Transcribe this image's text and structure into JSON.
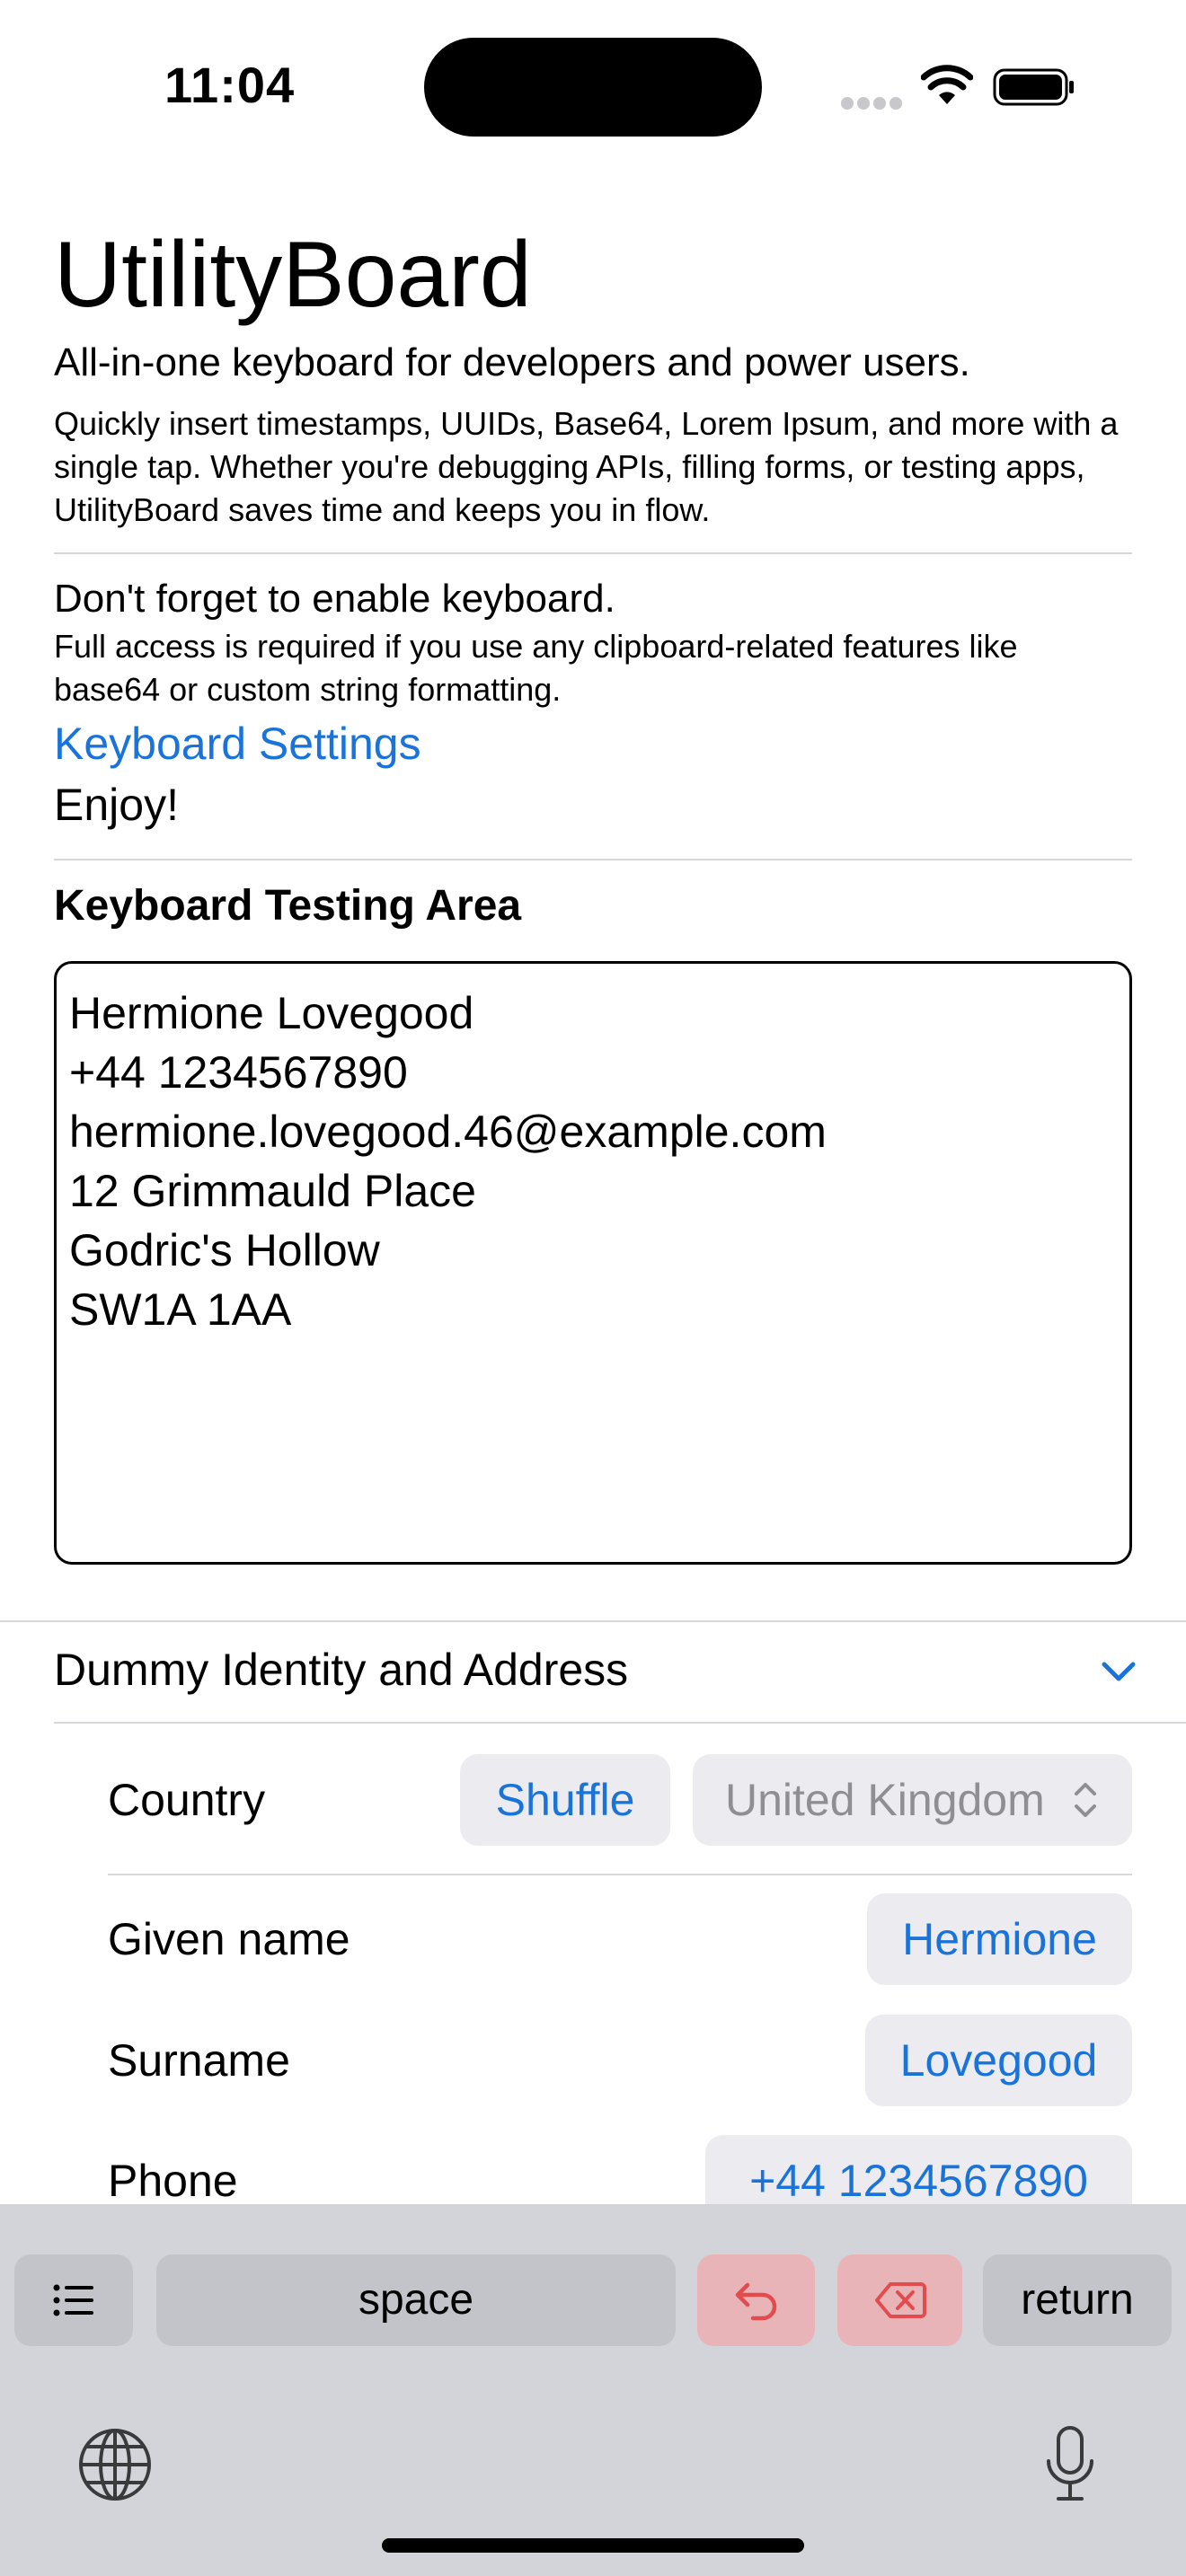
{
  "status_bar": {
    "time": "11:04",
    "icons": [
      "signal-icon",
      "wifi-icon",
      "battery-icon"
    ]
  },
  "header": {
    "title": "UtilityBoard",
    "subtitle": "All-in-one keyboard for developers and power users.",
    "description": "Quickly insert timestamps, UUIDs, Base64, Lorem Ipsum, and more with a single tap. Whether you're debugging APIs, filling forms, or testing apps, UtilityBoard saves time and keeps you in flow."
  },
  "enable": {
    "title": "Don't forget to enable keyboard.",
    "description": "Full access is required if you use any clipboard-related features like base64 or custom string formatting.",
    "settings_link": "Keyboard Settings",
    "enjoy": "Enjoy!"
  },
  "testing": {
    "title": "Keyboard Testing Area",
    "lines": [
      "Hermione Lovegood",
      "+44 1234567890",
      "hermione.lovegood.46@example.com",
      "12 Grimmauld Place",
      "Godric's Hollow",
      "SW1A 1AA"
    ]
  },
  "identity_section": {
    "title": "Dummy Identity and Address",
    "country_label": "Country",
    "shuffle_label": "Shuffle",
    "country_value": "United Kingdom",
    "given_name_label": "Given name",
    "given_name_value": "Hermione",
    "surname_label": "Surname",
    "surname_value": "Lovegood",
    "phone_label": "Phone",
    "phone_value": "+44 1234567890"
  },
  "keyboard": {
    "space_label": "space",
    "return_label": "return",
    "icons": [
      "list-icon",
      "undo-icon",
      "delete-icon",
      "globe-icon",
      "microphone-icon"
    ],
    "accent_blue": "#1a73d9",
    "danger_red": "#e34c4c"
  }
}
